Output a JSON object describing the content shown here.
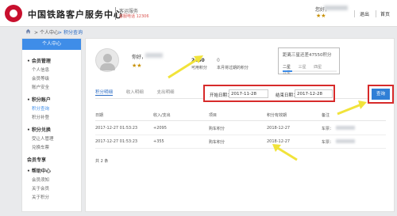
{
  "header": {
    "brand": "中国铁路客户服务中心",
    "subtitle": "客运服务",
    "hotline": "客服电话 12306",
    "user_prefix": "您好，",
    "badges": "★★",
    "logout": "退出",
    "home": "首页"
  },
  "breadcrumb": {
    "sep1": ">",
    "item1": "个人中心",
    "sep2": ">",
    "item2": "积分查询"
  },
  "sidebar": {
    "title": "个人中心",
    "sections": [
      {
        "label": "• 会员管理",
        "items": [
          "个人信息",
          "会员等级",
          "账户安全"
        ]
      },
      {
        "label": "• 积分账户",
        "items": [
          "积分查询",
          "积分补登"
        ]
      },
      {
        "label": "• 积分兑换",
        "items": [
          "受让人管理",
          "兑换车票"
        ]
      },
      {
        "label": "会员专享",
        "items": []
      },
      {
        "label": "• 帮助中心",
        "items": [
          "会员须知",
          "关于会员",
          "关于积分"
        ]
      }
    ]
  },
  "profile": {
    "greeting": "你好，",
    "badges": "★★",
    "points": "2450",
    "points_label": "可用积分",
    "expiring": "0",
    "expiring_label": "本月将过期的积分",
    "tier_title": "距离三星还差47550积分",
    "tier_tabs": [
      "二星",
      "三星",
      "四星",
      "五星"
    ]
  },
  "tabs": [
    "积分明细",
    "收入明细",
    "支出明细"
  ],
  "filter": {
    "start_label": "开始日期：",
    "start_value": "2017-11-28",
    "end_label": "结束日期：",
    "end_value": "2017-12-28",
    "query": "查询"
  },
  "table": {
    "headers": [
      "日期",
      "收入/支出",
      "项目",
      "积分有效期",
      "备注"
    ],
    "rows": [
      [
        "2017-12-27 01:53:23",
        "+2095",
        "购车积分",
        "2018-12-27",
        "车票："
      ],
      [
        "2017-12-27 01:53:23",
        "+355",
        "购车积分",
        "2018-12-27",
        "车票："
      ]
    ],
    "total": "共 2 条"
  }
}
